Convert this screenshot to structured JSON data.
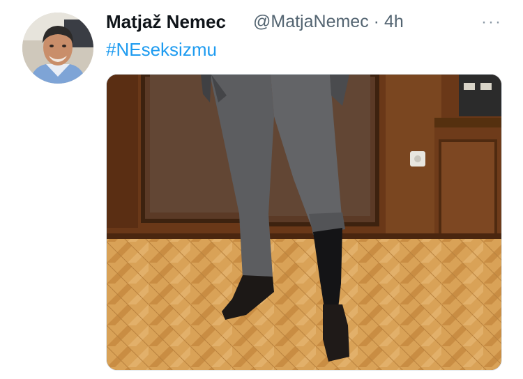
{
  "tweet": {
    "author_name": "Matjaž Nemec",
    "handle": "@MatjaNemec",
    "separator": "·",
    "time": "4h",
    "text": "#NEseksizmu",
    "more_label": "···"
  },
  "media": {
    "kind": "photo"
  },
  "colors": {
    "text_primary": "#0f1419",
    "text_secondary": "#536471",
    "link": "#1d9bf0"
  }
}
